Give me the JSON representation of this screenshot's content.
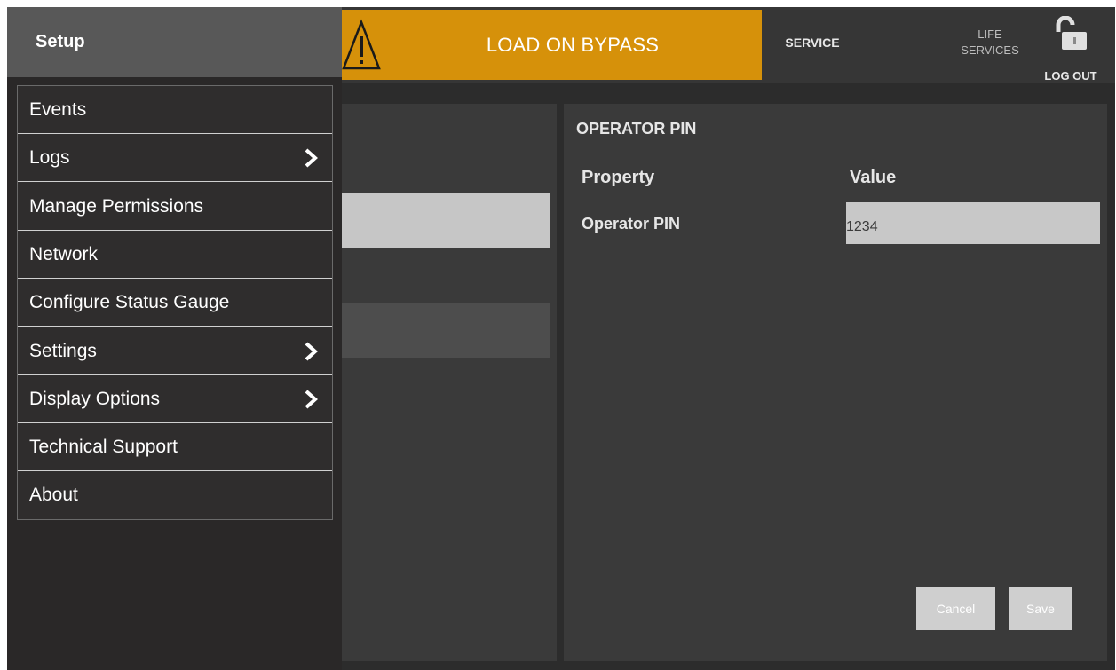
{
  "header": {
    "alarm_text": "LOAD ON BYPASS",
    "alarm_color": "#d6910a",
    "service_label": "SERVICE",
    "life_services_label": "LIFE\nSERVICES",
    "logout_label": "LOG OUT"
  },
  "setup_menu": {
    "title": "Setup",
    "items": [
      {
        "label": "Events",
        "has_submenu": false
      },
      {
        "label": "Logs",
        "has_submenu": true
      },
      {
        "label": "Manage Permissions",
        "has_submenu": false
      },
      {
        "label": "Network",
        "has_submenu": false
      },
      {
        "label": "Configure Status Gauge",
        "has_submenu": false
      },
      {
        "label": "Settings",
        "has_submenu": true
      },
      {
        "label": "Display Options",
        "has_submenu": true
      },
      {
        "label": "Technical Support",
        "has_submenu": false
      },
      {
        "label": "About",
        "has_submenu": false
      }
    ]
  },
  "operator_pin_panel": {
    "title": "OPERATOR PIN",
    "col_property": "Property",
    "col_value": "Value",
    "row_label": "Operator PIN",
    "pin_value": "1234",
    "cancel_label": "Cancel",
    "save_label": "Save"
  },
  "icons": {
    "alarm": "warning-triangle-icon",
    "logout": "unlocked-padlock-icon",
    "submenu": "chevron-right-icon"
  }
}
